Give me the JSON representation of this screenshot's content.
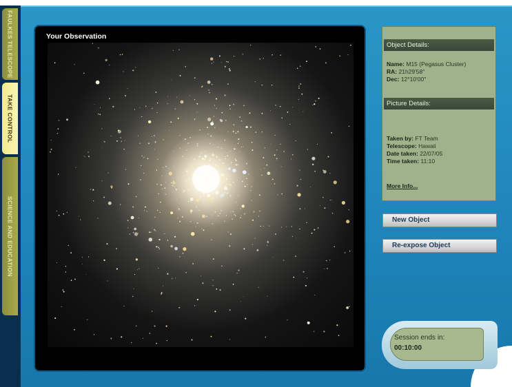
{
  "tabs": [
    {
      "label": "FAULKES TELESCOPE"
    },
    {
      "label": "TAKE CONTROL"
    },
    {
      "label": "SCIENCE AND EDUCATION"
    }
  ],
  "observation": {
    "title": "Your Observation"
  },
  "object_details": {
    "heading": "Object Details:",
    "name_label": "Name:",
    "name_value": "M15 (Pegasus Cluster)",
    "ra_label": "RA:",
    "ra_value": "21h29'58\"",
    "dec_label": "Dec:",
    "dec_value": "12°10'00\""
  },
  "picture_details": {
    "heading": "Picture Details:",
    "taken_by_label": "Taken by:",
    "taken_by_value": "FT Team",
    "telescope_label": "Telescope:",
    "telescope_value": "Hawaii",
    "date_label": "Date taken:",
    "date_value": "22/07/05",
    "time_label": "Time taken:",
    "time_value": "11:10",
    "more_info": "More Info..."
  },
  "buttons": {
    "new_object": "New Object",
    "reexpose_object": "Re-expose Object"
  },
  "session": {
    "label": "Session ends in:",
    "time": "00:10:00"
  },
  "colors": {
    "console_blue": "#1f86bb",
    "panel_green": "#9fb28b",
    "panel_header": "#39473a",
    "active_tab": "#f2ea8e"
  }
}
